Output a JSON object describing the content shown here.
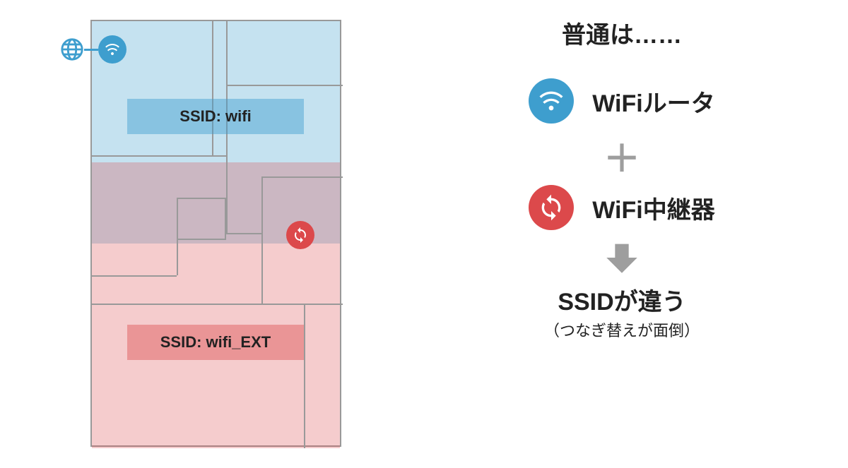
{
  "plan": {
    "ssid_router": "SSID: wifi",
    "ssid_extender": "SSID: wifi_EXT"
  },
  "explain": {
    "heading": "普通は……",
    "router_label": "WiFiルータ",
    "plus": "＋",
    "extender_label": "WiFi中継器",
    "conclusion": "SSIDが違う",
    "conclusion_sub": "（つなぎ替えが面倒）"
  },
  "colors": {
    "blue": "#3e9ece",
    "red": "#dc494b",
    "grey": "#9e9e9e"
  },
  "icons": {
    "globe": "globe-icon",
    "wifi": "wifi-icon",
    "sync": "sync-icon",
    "arrow_down": "arrow-down-icon"
  }
}
